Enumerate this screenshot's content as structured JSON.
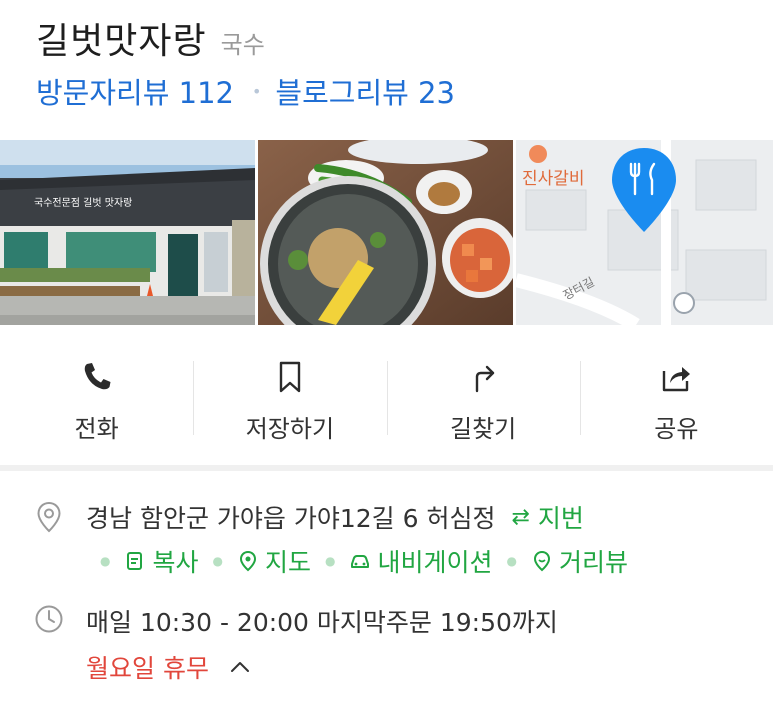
{
  "place": {
    "name": "길벗맛자랑",
    "category": "국수",
    "visitor_reviews": "방문자리뷰 112",
    "blog_reviews": "블로그리뷰 23"
  },
  "photos": [
    {
      "sign_text": "국수전문점  길벗 맛자랑"
    },
    {},
    {
      "map_labels": [
        "진사갈비",
        "장터길"
      ]
    }
  ],
  "actions": [
    {
      "label": "전화",
      "icon": "phone-icon"
    },
    {
      "label": "저장하기",
      "icon": "bookmark-icon"
    },
    {
      "label": "길찾기",
      "icon": "directions-icon"
    },
    {
      "label": "공유",
      "icon": "share-icon"
    }
  ],
  "address": {
    "text": "경남 함안군 가야읍 가야12길 6 허심정",
    "jibun": "지번",
    "links": [
      "복사",
      "지도",
      "내비게이션",
      "거리뷰"
    ]
  },
  "hours": {
    "text": "매일 10:30 - 20:00 마지막주문 19:50까지",
    "closed": "월요일 휴무"
  },
  "colors": {
    "link_blue": "#1f6ed4",
    "green": "#21a642",
    "red": "#e1463b",
    "map_pin": "#1a8cf0"
  }
}
